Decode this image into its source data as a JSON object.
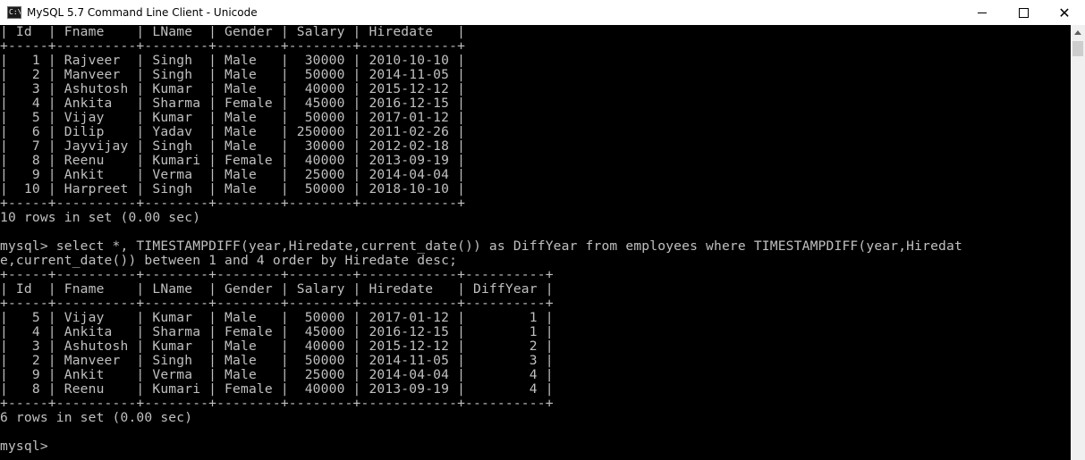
{
  "window": {
    "title": "MySQL 5.7 Command Line Client - Unicode",
    "icon": "console-app-icon",
    "icon_text": "C:\\"
  },
  "controls": {
    "minimize": "",
    "maximize": "",
    "close": "✕"
  },
  "console": {
    "lines": [
      "| Id  | Fname    | LName  | Gender | Salary | Hiredate   |",
      "+-----+----------+--------+--------+--------+------------+",
      "|   1 | Rajveer  | Singh  | Male   |  30000 | 2010-10-10 |",
      "|   2 | Manveer  | Singh  | Male   |  50000 | 2014-11-05 |",
      "|   3 | Ashutosh | Kumar  | Male   |  40000 | 2015-12-12 |",
      "|   4 | Ankita   | Sharma | Female |  45000 | 2016-12-15 |",
      "|   5 | Vijay    | Kumar  | Male   |  50000 | 2017-01-12 |",
      "|   6 | Dilip    | Yadav  | Male   | 250000 | 2011-02-26 |",
      "|   7 | Jayvijay | Singh  | Male   |  30000 | 2012-02-18 |",
      "|   8 | Reenu    | Kumari | Female |  40000 | 2013-09-19 |",
      "|   9 | Ankit    | Verma  | Male   |  25000 | 2014-04-04 |",
      "|  10 | Harpreet | Singh  | Male   |  50000 | 2018-10-10 |",
      "+-----+----------+--------+--------+--------+------------+",
      "10 rows in set (0.00 sec)",
      "",
      "mysql> select *, TIMESTAMPDIFF(year,Hiredate,current_date()) as DiffYear from employees where TIMESTAMPDIFF(year,Hiredat",
      "e,current_date()) between 1 and 4 order by Hiredate desc;",
      "+-----+----------+--------+--------+--------+------------+----------+",
      "| Id  | Fname    | LName  | Gender | Salary | Hiredate   | DiffYear |",
      "+-----+----------+--------+--------+--------+------------+----------+",
      "|   5 | Vijay    | Kumar  | Male   |  50000 | 2017-01-12 |        1 |",
      "|   4 | Ankita   | Sharma | Female |  45000 | 2016-12-15 |        1 |",
      "|   3 | Ashutosh | Kumar  | Male   |  40000 | 2015-12-12 |        2 |",
      "|   2 | Manveer  | Singh  | Male   |  50000 | 2014-11-05 |        3 |",
      "|   9 | Ankit    | Verma  | Male   |  25000 | 2014-04-04 |        4 |",
      "|   8 | Reenu    | Kumari | Female |  40000 | 2013-09-19 |        4 |",
      "+-----+----------+--------+--------+--------+------------+----------+",
      "6 rows in set (0.00 sec)",
      "",
      "mysql>"
    ]
  },
  "colors": {
    "console_bg": "#000000",
    "console_fg": "#c0c0c0",
    "titlebar_bg": "#ffffff",
    "scrollbar_bg": "#f0f0f0"
  }
}
